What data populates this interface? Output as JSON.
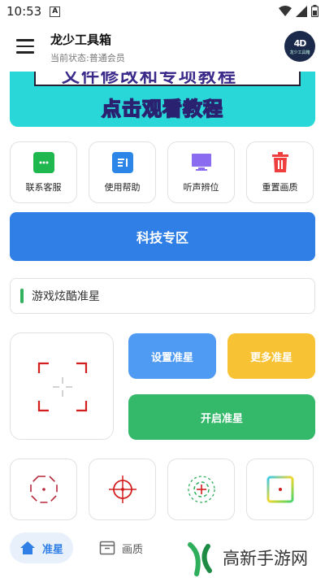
{
  "status_bar": {
    "time": "10:53",
    "notif_icon": "A"
  },
  "app_bar": {
    "title": "龙少工具箱",
    "subtitle": "当前状态:普通会员",
    "avatar_text": "龙少工具箱"
  },
  "banner": {
    "headline": "点击观看教程",
    "top_text": "文件修改和专项教程"
  },
  "tools": [
    {
      "label": "联系客服",
      "icon": "chat-icon",
      "color": "#1fb84f"
    },
    {
      "label": "使用帮助",
      "icon": "document-icon",
      "color": "#2b86e8"
    },
    {
      "label": "听声辨位",
      "icon": "monitor-icon",
      "color": "#8b6cf0"
    },
    {
      "label": "重置画质",
      "icon": "trash-icon",
      "color": "#ef3e3e"
    }
  ],
  "tech_zone_label": "科技专区",
  "section_title": "游戏炫酷准星",
  "buttons": {
    "set": "设置准星",
    "more": "更多准星",
    "open": "开启准星"
  },
  "presets": [
    "octagon-crosshair-icon",
    "circle-crosshair-icon",
    "dashed-circle-crosshair-icon",
    "gradient-square-crosshair-icon"
  ],
  "bottom_nav": {
    "active": "准星",
    "second": "画质"
  },
  "watermark": {
    "text": "高新手游网"
  },
  "colors": {
    "primary": "#2f7fe6",
    "yellow": "#f7c233",
    "green": "#34b86a",
    "crosshair_red": "#d21e1e"
  }
}
